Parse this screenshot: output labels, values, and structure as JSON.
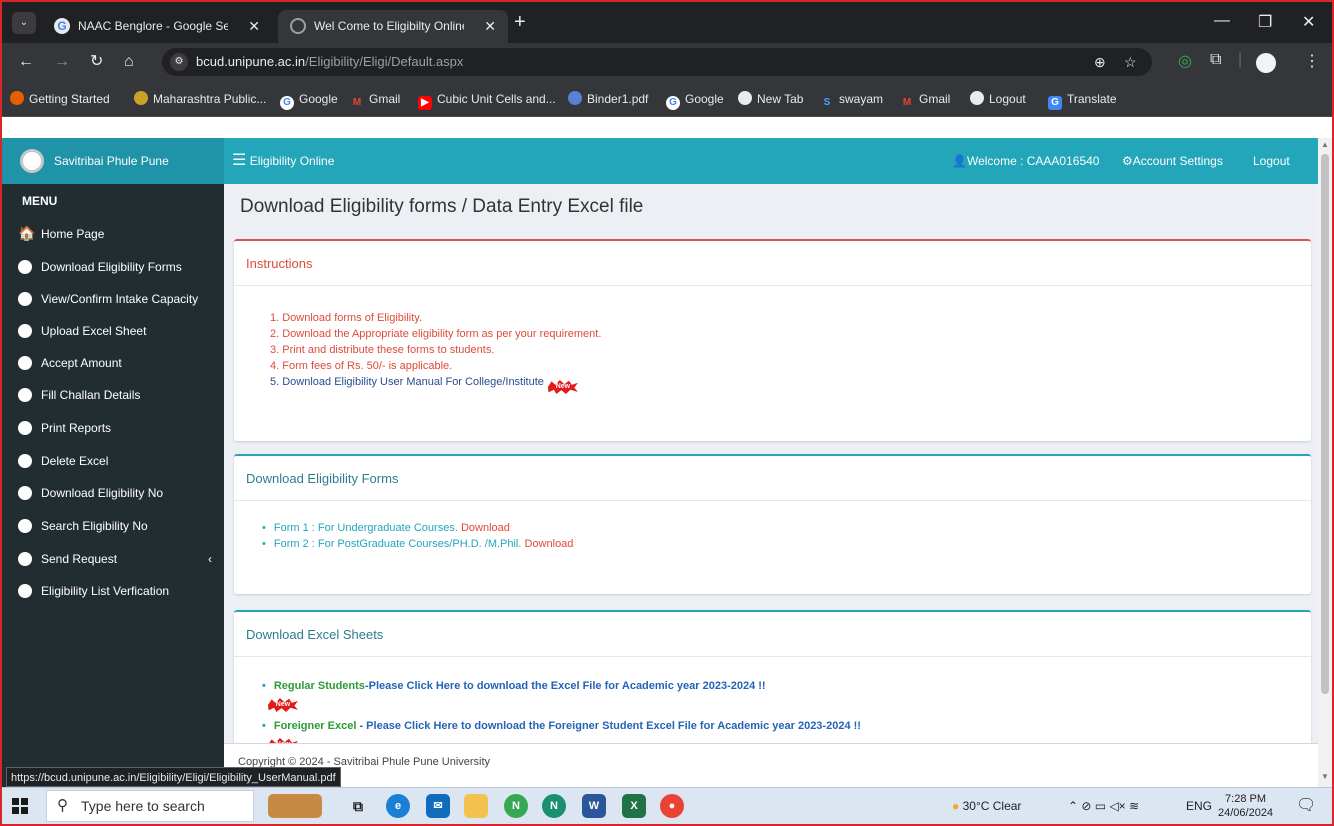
{
  "browser": {
    "tabs": [
      {
        "title": "NAAC Benglore - Google Searc",
        "icon": "google-icon"
      },
      {
        "title": "Wel Come to Eligibilty Online: D",
        "icon": "globe-icon"
      }
    ],
    "url_host": "bcud.unipune.ac.in",
    "url_path": "/Eligibility/Eligi/Default.aspx",
    "bookmarks": [
      "Getting Started",
      "Maharashtra Public...",
      "Google",
      "Gmail",
      "Cubic Unit Cells and...",
      "Binder1.pdf",
      "Google",
      "New Tab",
      "swayam",
      "Gmail",
      "Logout",
      "Translate"
    ],
    "status_url": "https://bcud.unipune.ac.in/Eligibility/Eligi/Eligibility_UserManual.pdf"
  },
  "site": {
    "brand": "Savitribai Phule Pune University",
    "nav_title": "Eligibility Online",
    "welcome": "Welcome : CAAA016540",
    "account_settings": "Account Settings",
    "logout": "Logout"
  },
  "sidebar": {
    "heading": "MENU",
    "items": [
      "Home Page",
      "Download Eligibility Forms",
      "View/Confirm Intake Capacity",
      "Upload Excel Sheet",
      "Accept Amount",
      "Fill Challan Details",
      "Print Reports",
      "Delete Excel",
      "Download Eligibility No",
      "Search Eligibility No",
      "Send Request",
      "Eligibility List Verfication"
    ]
  },
  "main": {
    "title": "Download Eligibility forms / Data Entry Excel file",
    "instructions": {
      "heading": "Instructions",
      "items": [
        "1. Download forms of Eligibility.",
        "2. Download the Appropriate eligibility form as per your requirement.",
        "3. Print and distribute these forms to students.",
        "4. Form fees of Rs. 50/- is applicable.",
        "5. Download Eligibility User Manual For College/Institute"
      ]
    },
    "forms": {
      "heading": "Download Eligibility Forms",
      "items": [
        {
          "text": "Form 1 : For Undergraduate Courses.",
          "link": "Download"
        },
        {
          "text": "Form 2 : For PostGraduate Courses/PH.D. /M.Phil.",
          "link": "Download"
        }
      ]
    },
    "excel": {
      "heading": "Download Excel Sheets",
      "items": [
        {
          "label": "Regular Students",
          "link": "-Please Click Here to download the Excel File for Academic year 2023-2024 !!"
        },
        {
          "label": "Foreigner Excel",
          "link": " - Please Click Here to download the Foreigner Student Excel File for Academic year 2023-2024 !!"
        }
      ]
    },
    "footer": "Copyright © 2024 - Savitribai Phule Pune University"
  },
  "badge": "New",
  "taskbar": {
    "search_placeholder": "Type here to search",
    "weather": "30°C  Clear",
    "lang": "ENG",
    "time": "7:28 PM",
    "date": "24/06/2024"
  },
  "colors": {
    "topnav": "#23a5ba",
    "sidebar": "#222d32",
    "instruction_red": "#dd4b39",
    "link_blue": "#2463b6"
  }
}
